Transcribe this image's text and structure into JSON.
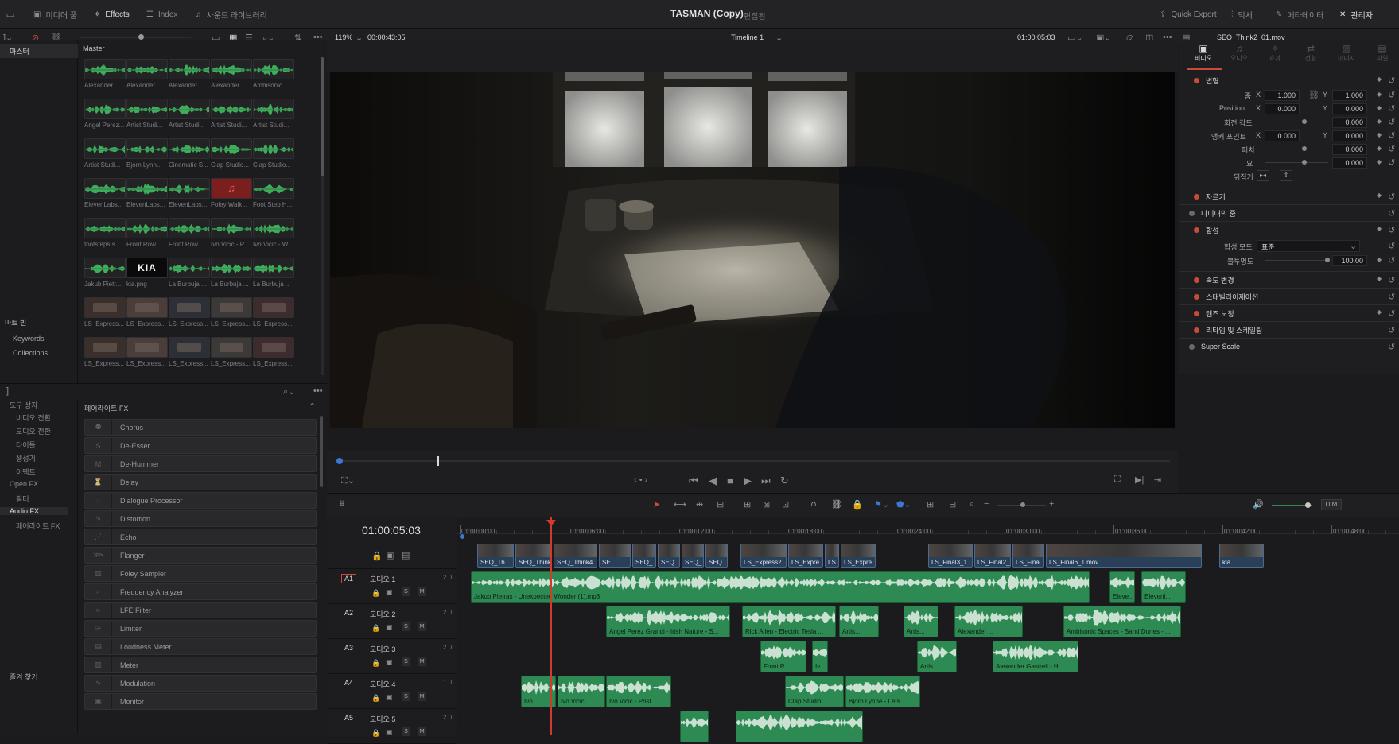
{
  "topbar": {
    "media_pool": "미디어 풀",
    "effects": "Effects",
    "index": "Index",
    "sound_library": "사운드 라이브러리",
    "project_title": "TASMAN (Copy)",
    "project_mode": "편집됨",
    "quick_export": "Quick Export",
    "mixer": "믹서",
    "metadata": "메타데이터",
    "inspector": "관리자"
  },
  "viewer_bar": {
    "zoom": "119%",
    "source_timecode": "00:00:43:05",
    "timeline_name": "Timeline 1",
    "record_timecode": "01:00:05:03",
    "clip_name": "SEQ_Think2_01.mov"
  },
  "bins": {
    "master": "마스터",
    "smart_bins": "마트 빈",
    "keywords": "Keywords",
    "collections": "Collections"
  },
  "pool": {
    "title": "Master",
    "items": [
      {
        "name": "Alexander ...",
        "kind": "audio"
      },
      {
        "name": "Alexander ...",
        "kind": "audio"
      },
      {
        "name": "Alexander ...",
        "kind": "audio"
      },
      {
        "name": "Alexander ...",
        "kind": "audio"
      },
      {
        "name": "Ambisonic ...",
        "kind": "audio"
      },
      {
        "name": "Angel Perez...",
        "kind": "audio"
      },
      {
        "name": "Artist Studi...",
        "kind": "audio"
      },
      {
        "name": "Artist Studi...",
        "kind": "audio"
      },
      {
        "name": "Artist Studi...",
        "kind": "audio"
      },
      {
        "name": "Artist Studi...",
        "kind": "audio"
      },
      {
        "name": "Artist Studi...",
        "kind": "audio"
      },
      {
        "name": "Bjorn Lynn...",
        "kind": "audio"
      },
      {
        "name": "Cinematic S...",
        "kind": "audio"
      },
      {
        "name": "Clap Studio...",
        "kind": "audio"
      },
      {
        "name": "Clap Studio...",
        "kind": "audio"
      },
      {
        "name": "ElevenLabs...",
        "kind": "audio"
      },
      {
        "name": "ElevenLabs...",
        "kind": "audio"
      },
      {
        "name": "ElevenLabs...",
        "kind": "audio"
      },
      {
        "name": "Foley Walk...",
        "kind": "red"
      },
      {
        "name": "Foot Step H...",
        "kind": "audio"
      },
      {
        "name": "footsteps s...",
        "kind": "audio"
      },
      {
        "name": "Front Row ...",
        "kind": "audio"
      },
      {
        "name": "Front Row ...",
        "kind": "audio"
      },
      {
        "name": "Ivo Vicic - P...",
        "kind": "audio"
      },
      {
        "name": "Ivo Vicic - W...",
        "kind": "audio"
      },
      {
        "name": "Jakub Pietr...",
        "kind": "audio"
      },
      {
        "name": "kia.png",
        "kind": "logo"
      },
      {
        "name": "La Burbuja ...",
        "kind": "audio"
      },
      {
        "name": "La Burbuja ...",
        "kind": "audio"
      },
      {
        "name": "La Burbuja ...",
        "kind": "audio"
      },
      {
        "name": "LS_Express...",
        "kind": "video"
      },
      {
        "name": "LS_Express...",
        "kind": "video"
      },
      {
        "name": "LS_Express...",
        "kind": "video"
      },
      {
        "name": "LS_Express...",
        "kind": "video"
      },
      {
        "name": "LS_Express...",
        "kind": "video"
      },
      {
        "name": "LS_Express...",
        "kind": "video"
      },
      {
        "name": "LS_Express...",
        "kind": "video"
      },
      {
        "name": "LS_Express...",
        "kind": "video"
      },
      {
        "name": "LS_Express...",
        "kind": "video"
      },
      {
        "name": "LS_Express...",
        "kind": "video"
      }
    ]
  },
  "toolbox": {
    "nav": [
      {
        "label": "도구 상자"
      },
      {
        "label": "비디오 전환"
      },
      {
        "label": "오디오 전환"
      },
      {
        "label": "타이틀"
      },
      {
        "label": "생성기"
      },
      {
        "label": "이펙트"
      },
      {
        "label": "Open FX"
      },
      {
        "label": "필터"
      },
      {
        "label": "Audio FX"
      },
      {
        "label": "페어라이트 FX"
      }
    ],
    "favorites": "즐겨 찾기",
    "section_title": "페어라이트 FX",
    "effects": [
      {
        "name": "Chorus",
        "icon": "chorus-icon"
      },
      {
        "name": "De-Esser",
        "icon": "deesser-icon"
      },
      {
        "name": "De-Hummer",
        "icon": "dehummer-icon"
      },
      {
        "name": "Delay",
        "icon": "delay-icon"
      },
      {
        "name": "Dialogue Processor",
        "icon": "dialogue-icon"
      },
      {
        "name": "Distortion",
        "icon": "distortion-icon"
      },
      {
        "name": "Echo",
        "icon": "echo-icon"
      },
      {
        "name": "Flanger",
        "icon": "flanger-icon"
      },
      {
        "name": "Foley Sampler",
        "icon": "sampler-icon"
      },
      {
        "name": "Frequency Analyzer",
        "icon": "analyzer-icon"
      },
      {
        "name": "LFE Filter",
        "icon": "lfe-icon"
      },
      {
        "name": "Limiter",
        "icon": "limiter-icon"
      },
      {
        "name": "Loudness Meter",
        "icon": "loudness-icon"
      },
      {
        "name": "Meter",
        "icon": "meter-icon"
      },
      {
        "name": "Modulation",
        "icon": "modulation-icon"
      },
      {
        "name": "Monitor",
        "icon": "monitor-icon"
      }
    ]
  },
  "inspector": {
    "tabs": [
      "비디오",
      "오디오",
      "효과",
      "전환",
      "이미지",
      "파일"
    ],
    "transform": {
      "title": "변형",
      "zoom_label": "줌",
      "zoom_x": "1.000",
      "zoom_y": "1.000",
      "position_label": "Position",
      "position_x": "0.000",
      "position_y": "0.000",
      "rotation_label": "회전 각도",
      "rotation": "0.000",
      "anchor_label": "앵커 포인트",
      "anchor_x": "0.000",
      "anchor_y": "0.000",
      "pitch_label": "피치",
      "pitch": "0.000",
      "yaw_label": "요",
      "yaw": "0.000",
      "flip_label": "뒤집기"
    },
    "crop": "자르기",
    "dynamic_zoom": "다이내믹 줌",
    "composite": {
      "title": "합성",
      "mode_label": "합성 모드",
      "mode_value": "표준",
      "opacity_label": "불투명도",
      "opacity": "100.00"
    },
    "speed_change": "속도 변경",
    "stabilization": "스태빌라이제이션",
    "lens_correction": "렌즈 보정",
    "retime_scaling": "리타임 및 스케일링",
    "super_scale": "Super Scale"
  },
  "timeline": {
    "timecode": "01:00:05:03",
    "ruler": [
      "01:00:00:00",
      "01:00:06:00",
      "01:00:12:00",
      "01:00:18:00",
      "01:00:24:00",
      "01:00:30:00",
      "01:00:36:00",
      "01:00:42:00",
      "01:00:48:00"
    ],
    "dim_label": "DIM",
    "audio_tracks": [
      {
        "id": "A1",
        "name": "오디오 1",
        "level": "2.0"
      },
      {
        "id": "A2",
        "name": "오디오 2",
        "level": "2.0"
      },
      {
        "id": "A3",
        "name": "오디오 3",
        "level": "2.0"
      },
      {
        "id": "A4",
        "name": "오디오 4",
        "level": "1.0"
      },
      {
        "id": "A5",
        "name": "오디오 5",
        "level": "2.0"
      }
    ],
    "video_clips": [
      "SEQ_Th...",
      "SEQ_Think...",
      "SEQ_Think4...",
      "SE...",
      "SEQ_...",
      "SEQ...",
      "SEQ_...",
      "SEQ...",
      "LS_Express2...",
      "LS_Expre...",
      "LS...",
      "LS_Expre...",
      "LS_Final3_1...",
      "LS_Final2_...",
      "LS_Final...",
      "LS_Final6_1.mov",
      "kia..."
    ],
    "a1_clips": [
      "Jakub Pietras - Unexpected Wonder (1).mp3",
      "Eleve...",
      "Elevenl..."
    ],
    "a2_clips": [
      "Angel Perez Grandi - Irish Nature - S...",
      "Rick Allen - Electric Tesla ...",
      "Artis...",
      "Artis...",
      "Alexander ...",
      "Ambisonic Spaces - Sand Dunes - ..."
    ],
    "a3_clips": [
      "Front R...",
      "Iv...",
      "Artis...",
      "Alexander Gastrell - H..."
    ],
    "a4_clips": [
      "Ivo ...",
      "Ivo Vicic...",
      "Ivo Vicic - Prist...",
      "Clap Studio...",
      "Bjorn Lynne - Lets..."
    ]
  }
}
